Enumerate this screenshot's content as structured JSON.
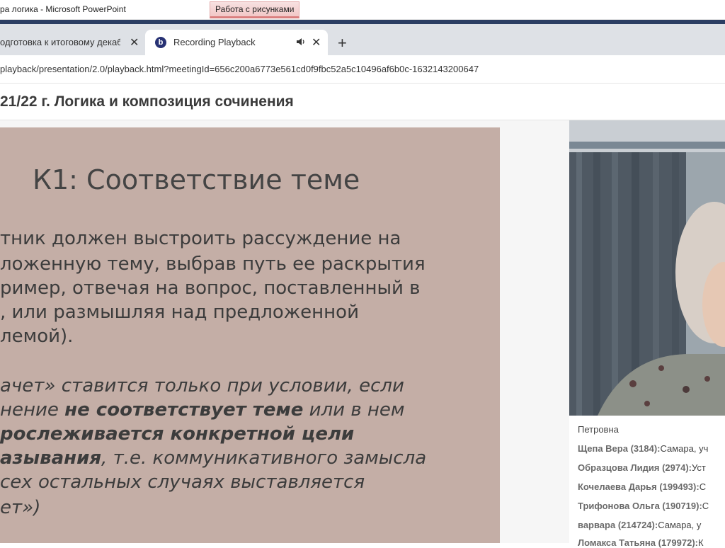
{
  "window": {
    "title": "ра логика - Microsoft PowerPoint",
    "context_tab": "Работа с рисунками"
  },
  "browser": {
    "tabs": [
      {
        "label": "одготовка к итоговому декабр"
      },
      {
        "label": "Recording Playback",
        "favicon": "b"
      }
    ],
    "url": "playback/presentation/2.0/playback.html?meetingId=656c200a6773e561cd0f9fbc52a5c10496af6b0c-1632143200647"
  },
  "page": {
    "title": "21/22 г. Логика и композиция сочинения"
  },
  "slide": {
    "title": "К1: Соответствие теме",
    "paragraph1": [
      "тник должен выстроить рассуждение на",
      "ложенную тему, выбрав путь ее раскрытия",
      "ример, отвечая на вопрос, поставленный в",
      ", или размышляя над предложенной",
      "лемой)."
    ],
    "paragraph2": {
      "l1": "ачет» ставится только при условии, если",
      "l2a": "нение ",
      "l2b": "не соответствует теме",
      "l2c": " или в нем",
      "l3": "рослеживается конкретной цели",
      "l4a": "азывания",
      "l4b": ", т.е. коммуникативного замысла",
      "l5": "сех остальных случаях выставляется",
      "l6": "ет»)"
    }
  },
  "participants": [
    {
      "text": "Петровна"
    },
    {
      "name": "Щепа Вера (3184):",
      "info": "Самара, уч"
    },
    {
      "name": "Образцова Лидия (2974):",
      "info": "Уст"
    },
    {
      "name": "Кочелаева Дарья (199493):",
      "info": "С"
    },
    {
      "name": "Трифонова Ольга (190719):",
      "info": "С"
    },
    {
      "name": "варвара (214724):",
      "info": "Самара, у"
    },
    {
      "name": "Ломакса Татьяна (179972):",
      "info": "К"
    }
  ]
}
